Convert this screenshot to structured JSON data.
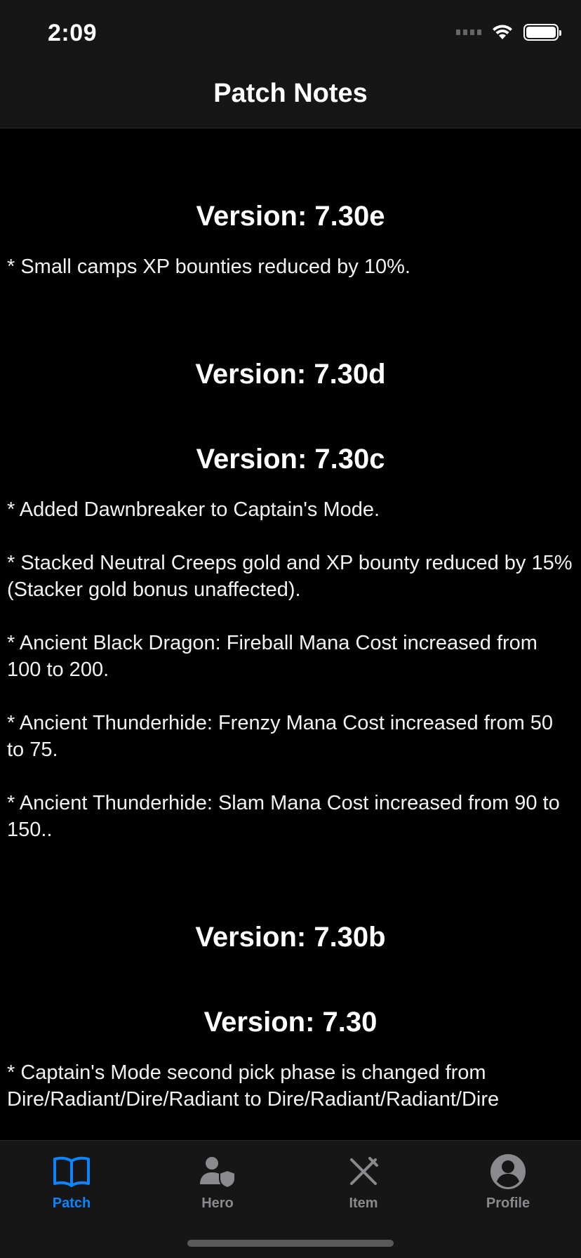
{
  "status": {
    "time": "2:09"
  },
  "nav": {
    "title": "Patch Notes"
  },
  "patches": [
    {
      "version": "Version: 7.30e",
      "notes": [
        "* Small camps XP bounties reduced by 10%."
      ]
    },
    {
      "version": "Version: 7.30d",
      "notes": []
    },
    {
      "version": "Version: 7.30c",
      "notes": [
        "* Added Dawnbreaker to Captain's Mode.",
        "* Stacked Neutral Creeps gold and XP bounty reduced by 15% (Stacker gold bonus unaffected).",
        "* Ancient Black Dragon: Fireball Mana Cost increased from 100 to 200.",
        "* Ancient Thunderhide: Frenzy Mana Cost increased from 50 to 75.",
        "* Ancient Thunderhide: Slam Mana Cost increased from 90 to 150.."
      ]
    },
    {
      "version": "Version: 7.30b",
      "notes": []
    },
    {
      "version": "Version: 7.30",
      "notes": [
        "* Captain's Mode second pick phase is changed from Dire/Radiant/Dire/Radiant to Dire/Radiant/Radiant/Dire"
      ]
    }
  ],
  "tabs": [
    {
      "label": "Patch",
      "icon": "book-icon",
      "active": true
    },
    {
      "label": "Hero",
      "icon": "hero-shield-icon",
      "active": false
    },
    {
      "label": "Item",
      "icon": "crossed-swords-icon",
      "active": false
    },
    {
      "label": "Profile",
      "icon": "profile-icon",
      "active": false
    }
  ],
  "colors": {
    "accent": "#0a84ff",
    "inactive": "#8a8a8e",
    "bar": "#161616",
    "background": "#000000"
  }
}
